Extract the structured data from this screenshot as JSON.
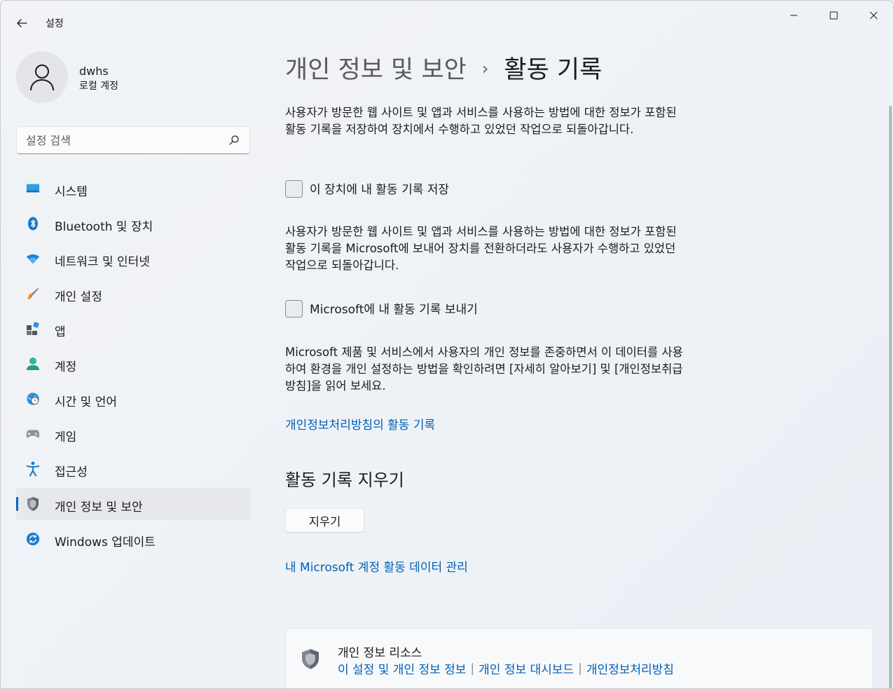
{
  "window": {
    "app_title": "설정"
  },
  "profile": {
    "name": "dwhs",
    "account_type": "로컬 계정"
  },
  "search": {
    "placeholder": "설정 검색"
  },
  "sidebar": {
    "items": [
      {
        "label": "시스템",
        "icon": "system-icon"
      },
      {
        "label": "Bluetooth 및 장치",
        "icon": "bluetooth-icon"
      },
      {
        "label": "네트워크 및 인터넷",
        "icon": "wifi-icon"
      },
      {
        "label": "개인 설정",
        "icon": "brush-icon"
      },
      {
        "label": "앱",
        "icon": "apps-icon"
      },
      {
        "label": "계정",
        "icon": "account-icon"
      },
      {
        "label": "시간 및 언어",
        "icon": "globe-clock-icon"
      },
      {
        "label": "게임",
        "icon": "gamepad-icon"
      },
      {
        "label": "접근성",
        "icon": "accessibility-icon"
      },
      {
        "label": "개인 정보 및 보안",
        "icon": "shield-icon",
        "active": true
      },
      {
        "label": "Windows 업데이트",
        "icon": "update-icon"
      }
    ]
  },
  "main": {
    "breadcrumb_parent": "개인 정보 및 보안",
    "breadcrumb_current": "활동 기록",
    "description1": "사용자가 방문한 웹 사이트 및 앱과 서비스를 사용하는 방법에 대한 정보가 포함된 활동 기록을 저장하여 장치에서 수행하고 있었던 작업으로 되돌아갑니다.",
    "checkbox1_label": "이 장치에 내 활동 기록 저장",
    "checkbox1_checked": false,
    "description2": "사용자가 방문한 웹 사이트 및 앱과 서비스를 사용하는 방법에 대한 정보가 포함된 활동 기록을 Microsoft에 보내어 장치를 전환하더라도 사용자가 수행하고 있었던 작업으로 되돌아갑니다.",
    "checkbox2_label": "Microsoft에 내 활동 기록 보내기",
    "checkbox2_checked": false,
    "description3": "Microsoft 제품 및 서비스에서 사용자의 개인 정보를 존중하면서 이 데이터를 사용하여 환경을 개인 설정하는 방법을 확인하려면 [자세히 알아보기] 및 [개인정보취급방침]을 읽어 보세요.",
    "privacy_link": "개인정보처리방침의 활동 기록",
    "clear_section_title": "활동 기록 지우기",
    "clear_button": "지우기",
    "manage_link": "내 Microsoft 계정 활동 데이터 관리"
  },
  "resources": {
    "title": "개인 정보 리소스",
    "links": [
      "이 설정 및 개인 정보 정보",
      "개인 정보 대시보드",
      "개인정보처리방침"
    ],
    "separator": "|"
  },
  "colors": {
    "accent": "#0067c0",
    "link": "#005fb7"
  }
}
